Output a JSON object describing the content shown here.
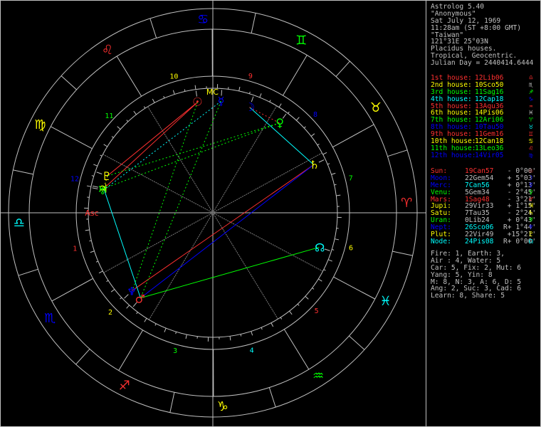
{
  "header": [
    "Astrolog 5.40",
    "\"Anonymous\"",
    "Sat July 12, 1969",
    "11:28am (ST +8:00 GMT)",
    "\"Taiwan\"",
    "121°31E 25°03N",
    "Placidus houses.",
    "Tropical, Geocentric.",
    "Julian Day = 2440414.6444"
  ],
  "houses": [
    {
      "label": "1st house:",
      "value": "12Lib06",
      "color": "#ff3030",
      "glyph": "♎",
      "gcolor": "#ff3030"
    },
    {
      "label": "2nd house:",
      "value": "10Sco50",
      "color": "#ffff00",
      "glyph": "♏",
      "gcolor": "#d0d0d0"
    },
    {
      "label": "3rd house:",
      "value": "11Sag16",
      "color": "#00ff00",
      "glyph": "♐",
      "gcolor": "#00ff00"
    },
    {
      "label": "4th house:",
      "value": "12Cap18",
      "color": "#00ffff",
      "glyph": "♑",
      "gcolor": "#0000ff"
    },
    {
      "label": "5th house:",
      "value": "13Aqu36",
      "color": "#ff3030",
      "glyph": "♒",
      "gcolor": "#ff3030"
    },
    {
      "label": "6th house:",
      "value": "14Pis06",
      "color": "#ffff00",
      "glyph": "♓",
      "gcolor": "#d0d0d0"
    },
    {
      "label": "7th house:",
      "value": "12Ari06",
      "color": "#00ff00",
      "glyph": "♈",
      "gcolor": "#00ff00"
    },
    {
      "label": "8th house:",
      "value": "10Tau50",
      "color": "#0000ff",
      "glyph": "♉",
      "gcolor": "#00ffff"
    },
    {
      "label": "9th house:",
      "value": "11Gem16",
      "color": "#ff3030",
      "glyph": "♊",
      "gcolor": "#ff3030"
    },
    {
      "label": "10th house:",
      "value": "12Can18",
      "color": "#ffff00",
      "glyph": "♋",
      "gcolor": "#ffff00"
    },
    {
      "label": "11th house:",
      "value": "13Leo36",
      "color": "#00ff00",
      "glyph": "♌",
      "gcolor": "#ff3030"
    },
    {
      "label": "12th house:",
      "value": "14Vir05",
      "color": "#0000ff",
      "glyph": "♍",
      "gcolor": "#0000ff"
    }
  ],
  "planets": [
    {
      "label": "Sun:",
      "pos": "19Can57",
      "r": " ",
      "motion": "- 0°00'",
      "color": "#ff3030",
      "pcolor": "#ff3030",
      "glyph": "☉"
    },
    {
      "label": "Moon:",
      "pos": "22Gem54",
      "r": " ",
      "motion": "+ 5°03'",
      "color": "#0000ff",
      "pcolor": "#c0c0c0",
      "glyph": "☽"
    },
    {
      "label": "Merc:",
      "pos": "7Can56",
      "r": " ",
      "motion": "+ 0°13'",
      "color": "#0000ff",
      "pcolor": "#00ffff",
      "glyph": "☿"
    },
    {
      "label": "Venu:",
      "pos": "5Gem34",
      "r": " ",
      "motion": "- 2°45'",
      "color": "#00ff00",
      "pcolor": "#c0c0c0",
      "glyph": "♀"
    },
    {
      "label": "Mars:",
      "pos": "1Sag48",
      "r": " ",
      "motion": "- 3°21'",
      "color": "#ff3030",
      "pcolor": "#ff3030",
      "glyph": "♂"
    },
    {
      "label": "Jupi:",
      "pos": "29Vir33",
      "r": " ",
      "motion": "+ 1°15'",
      "color": "#ffff00",
      "pcolor": "#c0c0c0",
      "glyph": "♃"
    },
    {
      "label": "Satu:",
      "pos": "7Tau35",
      "r": " ",
      "motion": "- 2°24'",
      "color": "#ffff00",
      "pcolor": "#c0c0c0",
      "glyph": "♄"
    },
    {
      "label": "Uran:",
      "pos": "0Lib24",
      "r": " ",
      "motion": "+ 0°43'",
      "color": "#00ff00",
      "pcolor": "#c0c0c0",
      "glyph": "♅"
    },
    {
      "label": "Nept:",
      "pos": "26Sco06",
      "r": "R",
      "motion": "+ 1°44'",
      "color": "#0000ff",
      "pcolor": "#00ffff",
      "glyph": "♆"
    },
    {
      "label": "Plut:",
      "pos": "22Vir49",
      "r": " ",
      "motion": "+15°21'",
      "color": "#ffff00",
      "pcolor": "#c0c0c0",
      "glyph": "♇"
    },
    {
      "label": "Node:",
      "pos": "24Pis08",
      "r": "R",
      "motion": "+ 0°00'",
      "color": "#00ffff",
      "pcolor": "#00ffff",
      "glyph": "☊"
    }
  ],
  "stats": [
    "Fire: 1, Earth: 3,",
    "Air : 4, Water: 5",
    "Car: 5, Fix: 2, Mut: 6",
    "Yang: 5, Yin: 8",
    "M: 8, N: 3, A: 6, D: 5",
    "Ang: 2, Suc: 3, Cad: 6",
    "Learn: 8, Share: 5"
  ],
  "wheel": {
    "signs": [
      {
        "glyph": "♎",
        "color": "#00ffff",
        "name": "libra"
      },
      {
        "glyph": "♍",
        "color": "#ffff00",
        "name": "virgo"
      },
      {
        "glyph": "♌",
        "color": "#ff3030",
        "name": "leo"
      },
      {
        "glyph": "♋",
        "color": "#0000ff",
        "name": "cancer"
      },
      {
        "glyph": "♊",
        "color": "#00ff00",
        "name": "gemini"
      },
      {
        "glyph": "♉",
        "color": "#ffff00",
        "name": "taurus"
      },
      {
        "glyph": "♈",
        "color": "#ff3030",
        "name": "aries"
      },
      {
        "glyph": "♓",
        "color": "#00ffff",
        "name": "pisces"
      },
      {
        "glyph": "♒",
        "color": "#00ff00",
        "name": "aquarius"
      },
      {
        "glyph": "♑",
        "color": "#ffff00",
        "name": "capricorn"
      },
      {
        "glyph": "♐",
        "color": "#ff3030",
        "name": "sagittarius"
      },
      {
        "glyph": "♏",
        "color": "#0000ff",
        "name": "scorpio"
      }
    ],
    "house_numbers": [
      {
        "n": "1",
        "color": "#ff3030"
      },
      {
        "n": "2",
        "color": "#ffff00"
      },
      {
        "n": "3",
        "color": "#00ff00"
      },
      {
        "n": "4",
        "color": "#00ffff"
      },
      {
        "n": "5",
        "color": "#ff3030"
      },
      {
        "n": "6",
        "color": "#ffff00"
      },
      {
        "n": "7",
        "color": "#00ff00"
      },
      {
        "n": "8",
        "color": "#0000ff"
      },
      {
        "n": "9",
        "color": "#ff3030"
      },
      {
        "n": "10",
        "color": "#ffff00"
      },
      {
        "n": "11",
        "color": "#00ff00"
      },
      {
        "n": "12",
        "color": "#0000ff"
      }
    ],
    "asc_label": "Asc",
    "mc_label": "MC"
  }
}
